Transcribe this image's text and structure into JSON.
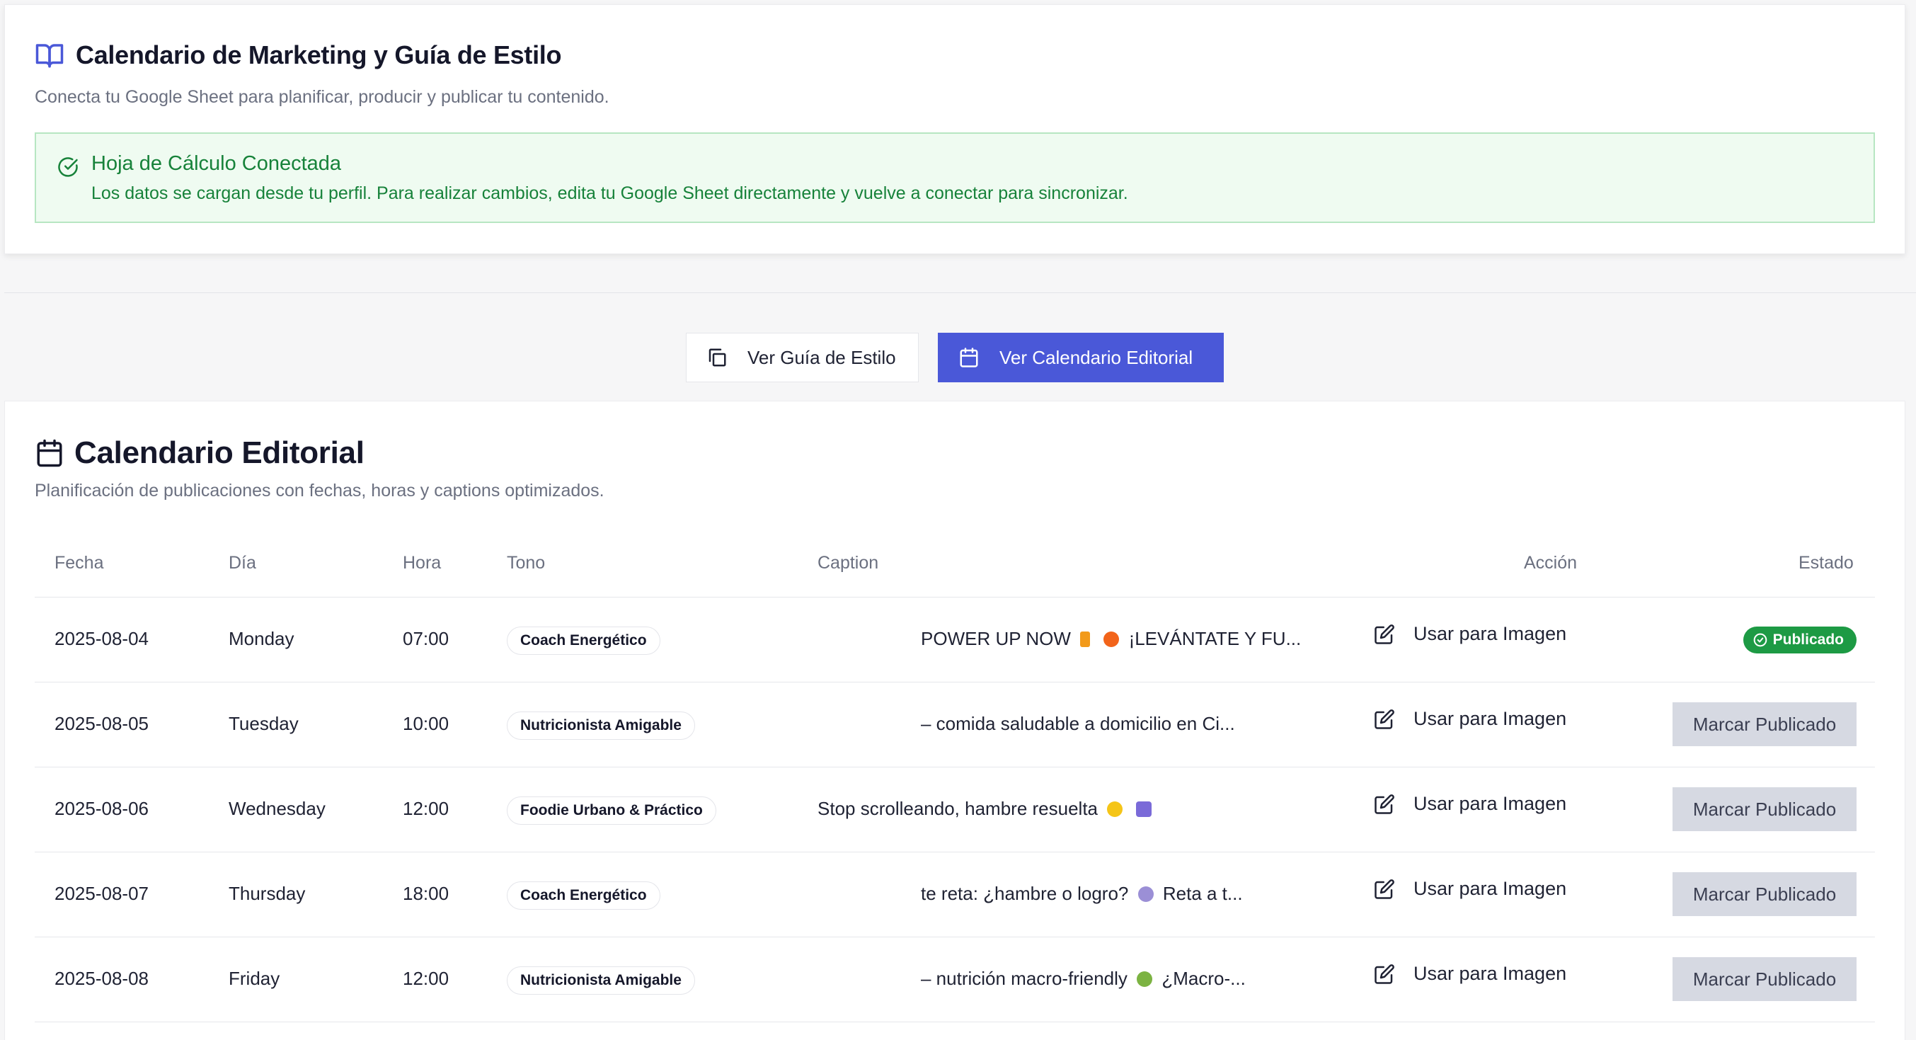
{
  "header": {
    "title": "Calendario de Marketing y Guía de Estilo",
    "subtitle": "Conecta tu Google Sheet para planificar, producir y publicar tu contenido."
  },
  "alert": {
    "title": "Hoja de Cálculo Conectada",
    "message": "Los datos se cargan desde tu perfil. Para realizar cambios, edita tu Google Sheet directamente y vuelve a conectar para sincronizar."
  },
  "toggle": {
    "guide_label": "Ver Guía de Estilo",
    "calendar_label": "Ver Calendario Editorial"
  },
  "calendar": {
    "title": "Calendario Editorial",
    "subtitle": "Planificación de publicaciones con fechas, horas y captions optimizados.",
    "columns": {
      "fecha": "Fecha",
      "dia": "Día",
      "hora": "Hora",
      "tono": "Tono",
      "caption": "Caption",
      "accion": "Acción",
      "estado": "Estado"
    },
    "action_label": "Usar para Imagen",
    "mark_label": "Marcar Publicado",
    "published_label": "Publicado",
    "rows": [
      {
        "fecha": "2025-08-04",
        "dia": "Monday",
        "hora": "07:00",
        "tono": "Coach Energético",
        "caption_a": "POWER UP NOW",
        "caption_b": "¡LEVÁNTATE Y FU...",
        "estado": "published"
      },
      {
        "fecha": "2025-08-05",
        "dia": "Tuesday",
        "hora": "10:00",
        "tono": "Nutricionista Amigable",
        "caption_a": "– comida saludable a domicilio en Ci...",
        "caption_b": "",
        "estado": "pending"
      },
      {
        "fecha": "2025-08-06",
        "dia": "Wednesday",
        "hora": "12:00",
        "tono": "Foodie Urbano & Práctico",
        "caption_a": "Stop scrolleando, hambre resuelta",
        "caption_b": "",
        "estado": "pending"
      },
      {
        "fecha": "2025-08-07",
        "dia": "Thursday",
        "hora": "18:00",
        "tono": "Coach Energético",
        "caption_a": "te reta: ¿hambre o logro?",
        "caption_b": "Reta a t...",
        "estado": "pending"
      },
      {
        "fecha": "2025-08-08",
        "dia": "Friday",
        "hora": "12:00",
        "tono": "Nutricionista Amigable",
        "caption_a": "– nutrición macro-friendly",
        "caption_b": "¿Macro-...",
        "estado": "pending"
      }
    ]
  },
  "colors": {
    "accent": "#4a58d8",
    "success": "#1d9a44",
    "alert_bg": "#effbf1"
  }
}
